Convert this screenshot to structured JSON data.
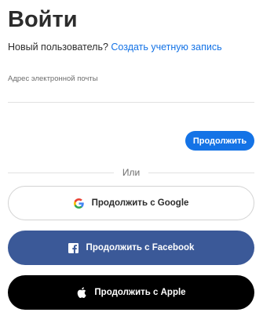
{
  "page": {
    "title": "Войти"
  },
  "new_user": {
    "question": "Новый пользователь?",
    "create_account_link": "Создать учетную запись"
  },
  "email": {
    "label": "Адрес электронной почты",
    "value": "",
    "placeholder": ""
  },
  "continue_button": {
    "label": "Продолжить"
  },
  "divider": {
    "text": "Или"
  },
  "social": {
    "google": {
      "label": "Продолжить с Google",
      "icon": "google-icon"
    },
    "facebook": {
      "label": "Продолжить с Facebook",
      "icon": "facebook-icon",
      "color": "#3b5998"
    },
    "apple": {
      "label": "Продолжить с Apple",
      "icon": "apple-icon",
      "color": "#000000"
    }
  },
  "colors": {
    "accent": "#1473e6",
    "text": "#2c2c2c",
    "muted": "#6e6e6e"
  }
}
